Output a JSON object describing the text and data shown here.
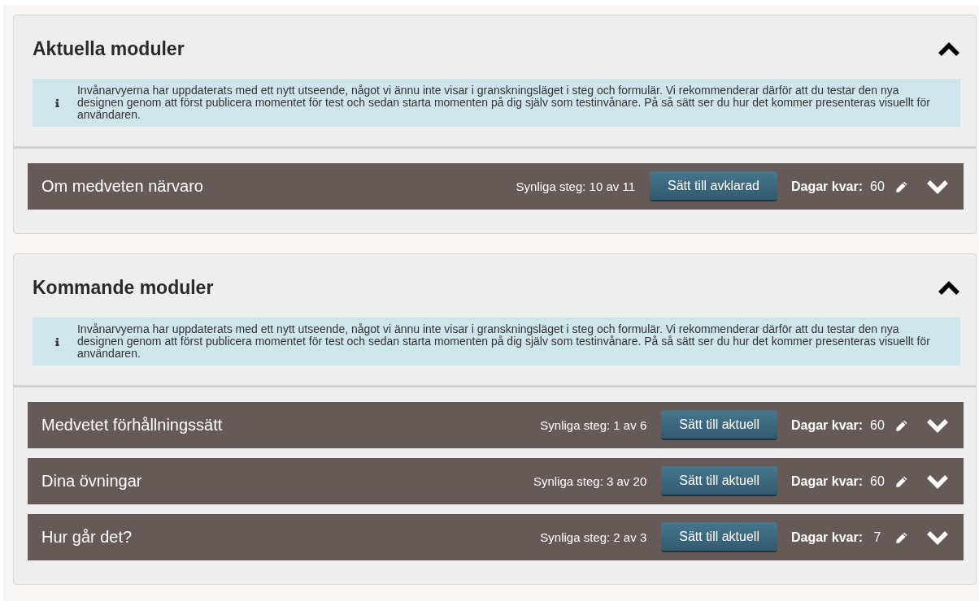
{
  "panels": [
    {
      "title": "Aktuella moduler",
      "expanded": true,
      "info": "Invånarvyerna har uppdaterats med ett nytt utseende, något vi ännu inte visar i granskningsläget i steg och formulär. Vi rekommenderar därför att du testar den nya designen genom att först publicera momentet för test och sedan starta momenten på dig själv som testinvånare. På så sätt ser du hur det kommer presenteras visuellt för användaren.",
      "modules": [
        {
          "name": "Om medveten närvaro",
          "steps": "Synliga steg: 10 av 11",
          "action": "Sätt till avklarad",
          "days_label": "Dagar kvar:",
          "days": "60",
          "expanded": false
        }
      ]
    },
    {
      "title": "Kommande moduler",
      "expanded": true,
      "info": "Invånarvyerna har uppdaterats med ett nytt utseende, något vi ännu inte visar i granskningsläget i steg och formulär. Vi rekommenderar därför att du testar den nya designen genom att först publicera momentet för test och sedan starta momenten på dig själv som testinvånare. På så sätt ser du hur det kommer presenteras visuellt för användaren.",
      "modules": [
        {
          "name": "Medvetet förhållningssätt",
          "steps": "Synliga steg: 1 av 6",
          "action": "Sätt till aktuell",
          "days_label": "Dagar kvar:",
          "days": "60",
          "expanded": false
        },
        {
          "name": "Dina övningar",
          "steps": "Synliga steg: 3 av 20",
          "action": "Sätt till aktuell",
          "days_label": "Dagar kvar:",
          "days": "60",
          "expanded": false
        },
        {
          "name": "Hur går det?",
          "steps": "Synliga steg: 2 av 3",
          "action": "Sätt till aktuell",
          "days_label": "Dagar kvar:",
          "days": "7",
          "expanded": false
        }
      ]
    }
  ]
}
